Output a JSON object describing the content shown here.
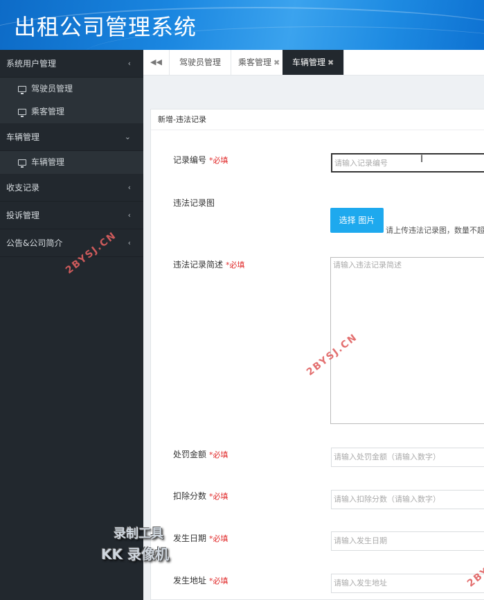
{
  "app": {
    "title": "出租公司管理系统"
  },
  "sidebar": {
    "groups": [
      {
        "label": "系统用户管理",
        "chevron": "‹",
        "items": [
          "驾驶员管理",
          "乘客管理"
        ]
      },
      {
        "label": "车辆管理",
        "chevron": "⌄",
        "items": [
          "车辆管理"
        ]
      },
      {
        "label": "收支记录",
        "chevron": "‹"
      },
      {
        "label": "投诉管理",
        "chevron": "‹"
      },
      {
        "label": "公告&公司简介",
        "chevron": "‹"
      }
    ]
  },
  "tabs": {
    "nav": "◀◀",
    "items": [
      {
        "label": "驾驶员管理",
        "close": ""
      },
      {
        "label": "乘客管理",
        "close": "✖"
      },
      {
        "label": "车辆管理",
        "close": "✖"
      }
    ]
  },
  "form": {
    "title": "新增-违法记录",
    "required_mark": "*必填",
    "fields": {
      "record_no": {
        "label": "记录编号",
        "placeholder": "请输入记录编号"
      },
      "image": {
        "label": "违法记录图",
        "button": "选择 图片",
        "hint": "请上传违法记录图，数量不超"
      },
      "summary": {
        "label": "违法记录简述",
        "placeholder": "请输入违法记录简述"
      },
      "fine": {
        "label": "处罚金额",
        "placeholder": "请输入处罚金额（请输入数字）"
      },
      "points": {
        "label": "扣除分数",
        "placeholder": "请输入扣除分数（请输入数字）"
      },
      "date": {
        "label": "发生日期",
        "placeholder": "请输入发生日期"
      },
      "address": {
        "label": "发生地址",
        "placeholder": "请输入发生地址"
      }
    }
  },
  "watermarks": {
    "site": "2BYSJ.CN",
    "site_partial": "2BY",
    "recorder_line1": "录制工具",
    "recorder_line2": "KK 录像机"
  },
  "colors": {
    "accent": "#1ea9ee",
    "required": "#e02a2a",
    "sidebar_bg": "#22282e",
    "header": "#1a86e0"
  }
}
